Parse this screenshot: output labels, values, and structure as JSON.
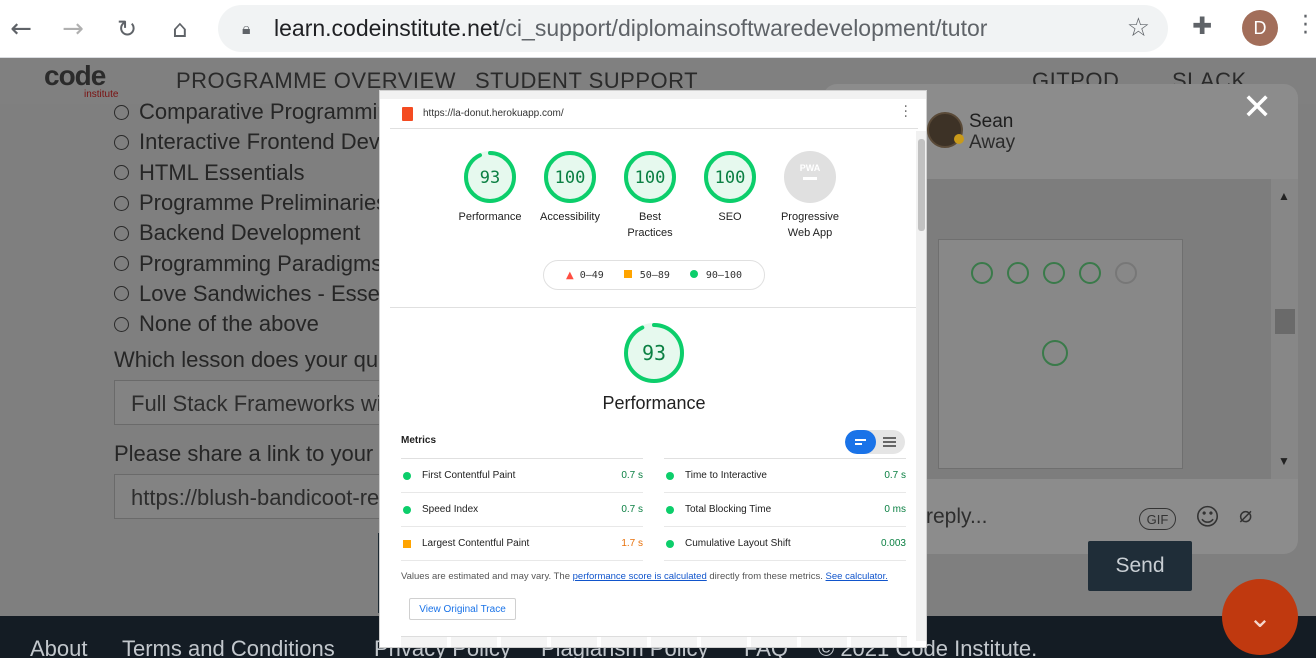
{
  "browser": {
    "url_host": "learn.codeinstitute.net",
    "url_path": "/ci_support/diplomainsoftwaredevelopment/tutor",
    "profile_initial": "D"
  },
  "site": {
    "logo_text": "code",
    "logo_sub": "institute",
    "nav": [
      "PROGRAMME OVERVIEW",
      "STUDENT SUPPORT",
      "GITPOD",
      "SLACK"
    ]
  },
  "form": {
    "options": [
      "Comparative Programming Languages",
      "Interactive Frontend Development",
      "HTML Essentials",
      "Programme Preliminaries",
      "Backend Development",
      "Programming Paradigms",
      "Love Sandwiches - Essentials Project",
      "None of the above"
    ],
    "lesson_question": "Which lesson does your question relate to?",
    "lesson_value": "Full Stack Frameworks with Django",
    "link_question": "Please share a link to your project",
    "link_value": "https://blush-bandicoot-repo"
  },
  "chat": {
    "agent_name": "Sean",
    "agent_status": "Away",
    "reply_placeholder": "reply...",
    "gif_label": "GIF",
    "send_label": "Send"
  },
  "footer": {
    "links": [
      "About",
      "Terms and Conditions",
      "Privacy Policy",
      "Plagiarism Policy",
      "FAQ",
      "© 2021 Code Institute."
    ]
  },
  "lighthouse": {
    "url": "https://la-donut.herokuapp.com/",
    "scores": [
      {
        "label_1": "Performance",
        "label_2": "",
        "value": "93",
        "pct": 0.93
      },
      {
        "label_1": "Accessibility",
        "label_2": "",
        "value": "100",
        "pct": 1.0
      },
      {
        "label_1": "Best",
        "label_2": "Practices",
        "value": "100",
        "pct": 1.0
      },
      {
        "label_1": "SEO",
        "label_2": "",
        "value": "100",
        "pct": 1.0
      },
      {
        "label_1": "Progressive",
        "label_2": "Web App",
        "value": "PWA",
        "pct": 0
      }
    ],
    "legend": {
      "low": "0–49",
      "mid": "50–89",
      "high": "90–100"
    },
    "main_score": "93",
    "main_label": "Performance",
    "metrics_title": "Metrics",
    "metrics": [
      {
        "name": "First Contentful Paint",
        "value": "0.7 s",
        "status": "good"
      },
      {
        "name": "Speed Index",
        "value": "0.7 s",
        "status": "good"
      },
      {
        "name": "Largest Contentful Paint",
        "value": "1.7 s",
        "status": "avg"
      },
      {
        "name": "Time to Interactive",
        "value": "0.7 s",
        "status": "good"
      },
      {
        "name": "Total Blocking Time",
        "value": "0 ms",
        "status": "good"
      },
      {
        "name": "Cumulative Layout Shift",
        "value": "0.003",
        "status": "good"
      }
    ],
    "note_prefix": "Values are estimated and may vary. The ",
    "note_link": "performance score is calculated",
    "note_mid": " directly from these metrics. ",
    "note_link2": "See calculator.",
    "trace_button": "View Original Trace"
  },
  "colors": {
    "good": "#0cce6b",
    "average": "#ffa400",
    "fail": "#ff4e42",
    "brand_orange": "#c0390f"
  }
}
